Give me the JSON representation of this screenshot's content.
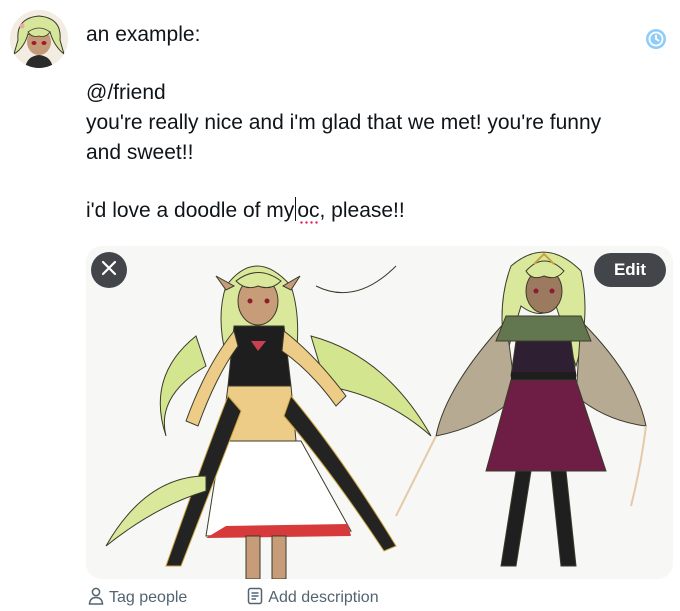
{
  "compose": {
    "line1": "an example:",
    "line2": "@/friend",
    "line3": "you're really nice and i'm glad that we met! you're funny",
    "line4": "and sweet!!",
    "line5_before_caret": "i'd love a doodle of my",
    "line5_misspelled": "oc",
    "line5_after": ", please!!"
  },
  "media": {
    "edit_label": "Edit",
    "close_icon": "close-icon"
  },
  "actions": {
    "tag_people_label": "Tag people",
    "add_description_label": "Add description"
  },
  "colors": {
    "accent": "#1d9bf0",
    "muted": "#536471",
    "overlay": "#0f1419"
  }
}
